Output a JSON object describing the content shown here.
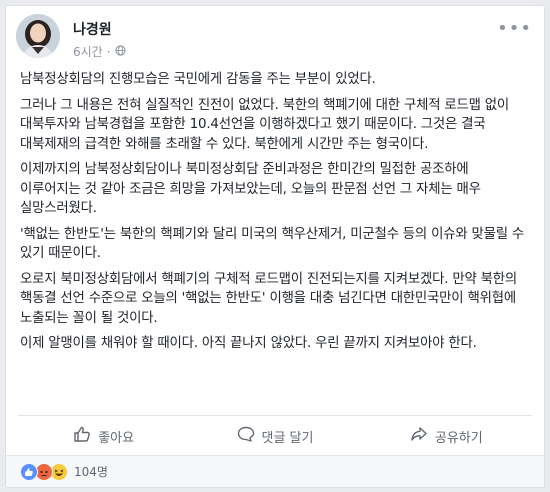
{
  "post": {
    "author": "나경원",
    "time": "6시간",
    "paragraphs": [
      "남북정상회담의 진행모습은 국민에게 감동을 주는 부분이 있었다.",
      "그러나 그 내용은 전혀 실질적인 진전이 없었다. 북한의 핵폐기에 대한 구체적 로드맵 없이 대북투자와 남북경협을 포함한 10.4선언을 이행하겠다고 했기 때문이다. 그것은 결국 대북제재의 급격한 와해를 초래할 수 있다. 북한에게 시간만 주는 형국이다.",
      "이제까지의 남북정상회담이나 북미정상회담 준비과정은 한미간의 밀접한 공조하에 이루어지는 것 같아 조금은 희망을 가져보았는데, 오늘의 판문점 선언 그 자체는 매우 실망스러웠다.",
      "'핵없는 한반도'는 북한의 핵폐기와 달리 미국의 핵우산제거, 미군철수 등의 이슈와 맞물릴 수 있기 때문이다.",
      "오로지 북미정상회담에서 핵폐기의 구체적 로드맵이 진전되는지를 지켜보겠다. 만약 북한의 핵동결 선언 수준으로 오늘의 '핵없는 한반도' 이행을 대충 넘긴다면 대한민국만이 핵위협에 노출되는 꼴이 될 것이다.",
      "이제 알맹이를 채워야 할 때이다. 아직 끝나지 않았다. 우린 끝까지 지켜보아야 한다."
    ]
  },
  "actions": {
    "like": "좋아요",
    "comment": "댓글 달기",
    "share": "공유하기"
  },
  "reactions": {
    "count": "104명",
    "icons": [
      "like-reaction-icon",
      "angry-reaction-icon",
      "haha-reaction-icon"
    ]
  },
  "colors": {
    "like_blue": "#5890ff",
    "angry_orange": "#f0663c",
    "haha_yellow": "#f7c93e"
  }
}
